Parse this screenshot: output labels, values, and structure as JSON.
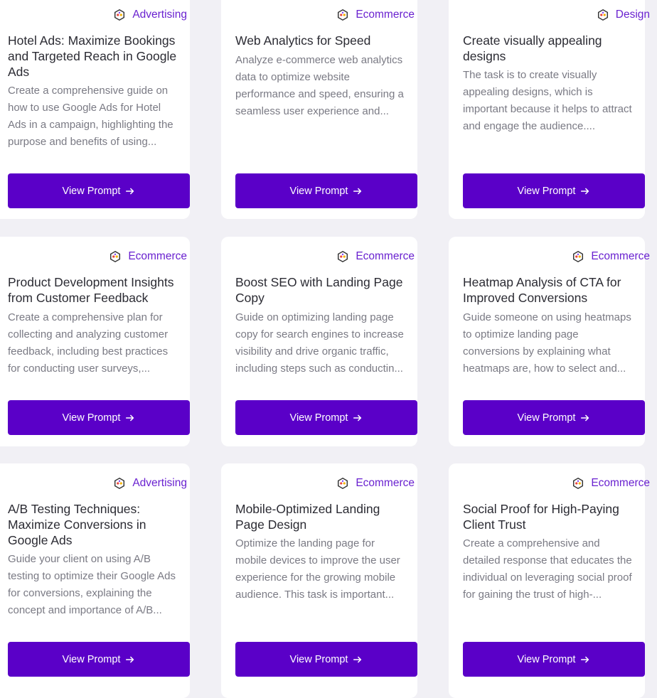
{
  "colors": {
    "accent": "#5a00c8",
    "category": "#6a22d0",
    "background": "#f1f0f5"
  },
  "icons": {
    "category": "category-badge-icon",
    "button": "arrow-right-icon"
  },
  "cards": [
    {
      "category": "Advertising",
      "title": "Hotel Ads: Maximize Bookings and Targeted Reach in Google Ads",
      "description": "Create a comprehensive guide on how to use Google Ads for Hotel Ads in a campaign, highlighting the purpose and benefits of using...",
      "button": "View Prompt"
    },
    {
      "category": "Ecommerce",
      "title": "Web Analytics for Speed",
      "description": "Analyze e-commerce web analytics data to optimize website performance and speed, ensuring a seamless user experience and...",
      "button": "View Prompt"
    },
    {
      "category": "Design",
      "title": "Create visually appealing designs",
      "description": "The task is to create visually appealing designs, which is important because it helps to attract and engage the audience....",
      "button": "View Prompt"
    },
    {
      "category": "Ecommerce",
      "title": "Product Development Insights from Customer Feedback",
      "description": "Create a comprehensive plan for collecting and analyzing customer feedback, including best practices for conducting user surveys,...",
      "button": "View Prompt"
    },
    {
      "category": "Ecommerce",
      "title": "Boost SEO with Landing Page Copy",
      "description": "Guide on optimizing landing page copy for search engines to increase visibility and drive organic traffic, including steps such as conductin...",
      "button": "View Prompt"
    },
    {
      "category": "Ecommerce",
      "title": "Heatmap Analysis of CTA for Improved Conversions",
      "description": "Guide someone on using heatmaps to optimize landing page conversions by explaining what heatmaps are, how to select and...",
      "button": "View Prompt"
    },
    {
      "category": "Advertising",
      "title": "A/B Testing Techniques: Maximize Conversions in Google Ads",
      "description": "Guide your client on using A/B testing to optimize their Google Ads for conversions, explaining the concept and importance of A/B...",
      "button": "View Prompt"
    },
    {
      "category": "Ecommerce",
      "title": "Mobile-Optimized Landing Page Design",
      "description": "Optimize the landing page for mobile devices to improve the user experience for the growing mobile audience. This task is important...",
      "button": "View Prompt"
    },
    {
      "category": "Ecommerce",
      "title": "Social Proof for High-Paying Client Trust",
      "description": "Create a comprehensive and detailed response that educates the individual on leveraging social proof for gaining the trust of high-...",
      "button": "View Prompt"
    }
  ]
}
